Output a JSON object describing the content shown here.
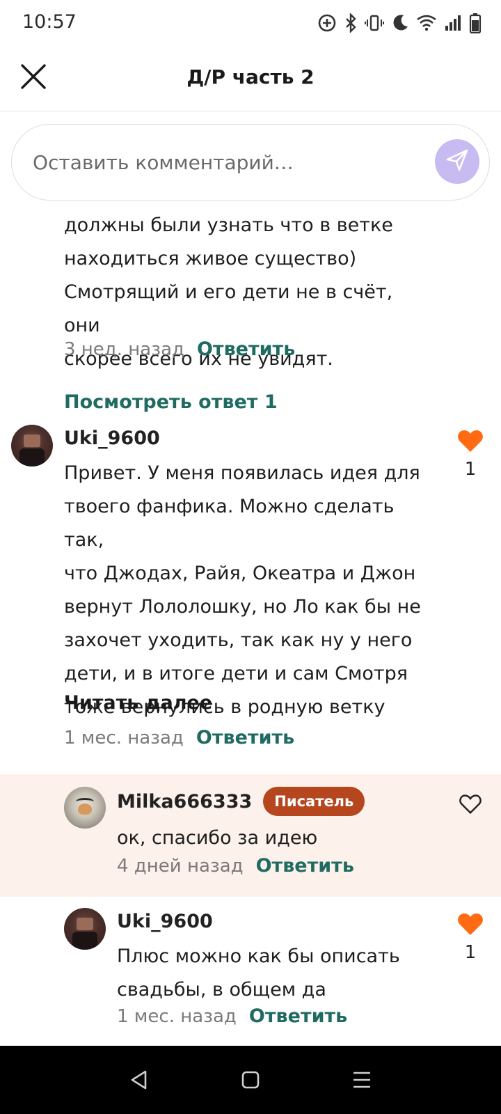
{
  "status_bar": {
    "time": "10:57",
    "icons": [
      "sync-icon",
      "bluetooth-icon",
      "vibrate-icon",
      "do-not-disturb-icon",
      "wifi-icon",
      "signal-icon",
      "battery-icon"
    ]
  },
  "header": {
    "title": "Д/Р часть 2",
    "close_icon": "close-icon"
  },
  "comment_input": {
    "placeholder": "Оставить комментарий…",
    "send_icon": "send-icon",
    "send_color": "#c8bbf1"
  },
  "previous_comment": {
    "text_lines": [
      "должны были узнать что в ветке",
      "находиться живое существо)",
      "Смотрящий и его дети не в счёт, они",
      "скорее всего их не увидят."
    ],
    "time": "3 нед. назад",
    "reply_label": "Ответить",
    "view_replies": "Посмотреть ответ 1"
  },
  "comments": [
    {
      "username": "Uki_9600",
      "text_lines": [
        "Привет. У меня появилась идея для",
        "твоего фанфика. Можно сделать так,",
        "что Джодах, Райя, Океатра и Джон",
        "вернут Лололошку, но Ло как бы не",
        "захочет уходить, так как ну у него",
        "дети, и в итоге дети и сам Смотря",
        "тоже вернулись в родную ветку"
      ],
      "read_more": "Читать далее",
      "time": "1 мес. назад",
      "reply_label": "Ответить",
      "liked": true,
      "likes": "1"
    },
    {
      "username": "Milka666333",
      "badge": "Писатель",
      "text": "ок, спасибо за идею",
      "time": "4 дней назад",
      "reply_label": "Ответить",
      "liked": false,
      "likes": "",
      "highlight_color": "#fdf1ec"
    },
    {
      "username": "Uki_9600",
      "text_lines": [
        "Плюс можно как бы описать",
        "свадьбы, в общем да"
      ],
      "time": "1 мес. назад",
      "reply_label": "Ответить",
      "liked": true,
      "likes": "1"
    }
  ],
  "colors": {
    "accent_green": "#1f6b62",
    "heart_orange": "#ff6a13",
    "badge_brown": "#b5461d"
  },
  "nav": {
    "icons": [
      "back-icon",
      "home-icon",
      "menu-icon"
    ]
  }
}
